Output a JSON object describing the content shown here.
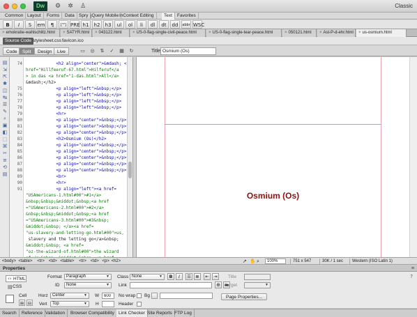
{
  "window": {
    "workspace": "Classic"
  },
  "insert_tabs": [
    "Common",
    "Layout",
    "Forms",
    "Data",
    "Spry",
    "jQuery Mobile",
    "InContext Editing",
    "Text",
    "Favorites"
  ],
  "text_toolbar": [
    "B",
    "I",
    "S",
    "em",
    "¶",
    "[\"\"]",
    "PRE",
    "h1",
    "h2",
    "h3",
    "ul",
    "ol",
    "li",
    "dl",
    "dt",
    "dd",
    "abbr",
    "WSC"
  ],
  "doc_tabs": [
    "emokratie-wahlschlitz.html",
    "SATYR.html",
    "043122.html",
    "US-0-flag-single-civil-peace.html",
    "US-0-flag-single-tear-peace.html",
    "050121.html",
    "Ast-P-d-ehr.html",
    "us-osmium.html"
  ],
  "related_files": [
    "Source Code",
    "stylesheet.css",
    "favicon.ico"
  ],
  "view_buttons": [
    "Code",
    "Split",
    "Design",
    "Live"
  ],
  "title_field": {
    "label": "Title:",
    "value": "Osmium (Os)"
  },
  "code": {
    "line_numbers": [
      "74",
      "",
      "",
      "",
      "75",
      "76",
      "77",
      "78",
      "79",
      "80",
      "81",
      "82",
      "83",
      "84",
      "85",
      "86",
      "87",
      "88",
      "89",
      "90",
      "91",
      "",
      "",
      "",
      "",
      "",
      "",
      "",
      "",
      "",
      "",
      "",
      ""
    ],
    "lines": [
      "            <h2 align=\"center\">&mdash; <a",
      "href=\"Hillfeeruf-67.html\">Hilferuf</a",
      "> in das <a href=\"1-das.html\">All</a>",
      "&mdash;</h2>",
      "            <p align=\"left\">&nbsp;</p>",
      "            <p align=\"left\">&nbsp;</p>",
      "            <p align=\"left\">&nbsp;</p>",
      "            <p align=\"left\">&nbsp;</p>",
      "            <hr>",
      "            <p align=\"center\">&nbsp;</p>",
      "            <p align=\"center\">&nbsp;</p>",
      "            <p align=\"center\">&nbsp;</p>",
      "            <h2>Osmium (Os)</h2>",
      "            <p align=\"center\">&nbsp;</p>",
      "            <p align=\"center\">&nbsp;</p>",
      "            <p align=\"center\">&nbsp;</p>",
      "            <p align=\"center\">&nbsp;</p>",
      "            <p align=\"center\">&nbsp;</p>",
      "            <br>",
      "            <hr>",
      "            <p align=\"left\"><a href=",
      "\"USAmericans-1.html#00\">#1</a>",
      "&nbsp;&nbsp;&middot;&nbsp;<a href",
      "=\"USAmericans-2.html#00\">#2</a>",
      "&nbsp;&nbsp;&middot;&nbsp;<a href",
      "=\"USAmericans-3.html#00\">#3&nbsp;",
      "&middot;&nbsp; </a><a href=",
      "\"us-slavery-and-letting-go.html#00\">us,",
      " slavery and the letting go</a>&nbsp;",
      "&middot;&nbsp; <a href=",
      "\"oz-the-wizard-of.html#00\">the wizard",
      "of</a>&nbsp; &middot;&nbsp; <a href=",
      "\"us-oz-html#00\">us-in </a>"
    ]
  },
  "design": {
    "heading": "Osmium (Os)"
  },
  "status": {
    "tag_path": [
      "<body>",
      "<table>",
      "<tr>",
      "<td>",
      "<table>",
      "<tr>",
      "<td>",
      "<p>",
      "<h2>"
    ],
    "zoom": "100%",
    "dimensions": "751 x 547",
    "filesize": "30K / 1 sec",
    "encoding": "Western (ISO Latin 1)"
  },
  "properties": {
    "panel_title": "Properties",
    "html_label": "HTML",
    "css_label": "CSS",
    "format_label": "Format",
    "format_value": "Paragraph",
    "class_label": "Class",
    "class_value": "None",
    "id_label": "ID",
    "id_value": "None",
    "link_label": "Link",
    "title_label": "Title",
    "target_label": "Target",
    "cell_label": "Cell",
    "horz_label": "Horz",
    "horz_value": "Center",
    "vert_label": "Vert",
    "vert_value": "Top",
    "w_label": "W",
    "w_value": "600",
    "h_label": "H",
    "nowrap_label": "No wrap",
    "bg_label": "Bg",
    "header_label": "Header",
    "page_properties": "Page Properties..."
  },
  "bottom_tabs": [
    "Search",
    "Reference",
    "Validation",
    "Browser Compatibility",
    "Link Checker",
    "Site Reports",
    "FTP Log"
  ],
  "colors": {
    "heading_red": "#8b1010",
    "tag_blue": "#0a0aa8",
    "attr_red": "#8b1a1a",
    "string_green": "#0a7a0a"
  }
}
